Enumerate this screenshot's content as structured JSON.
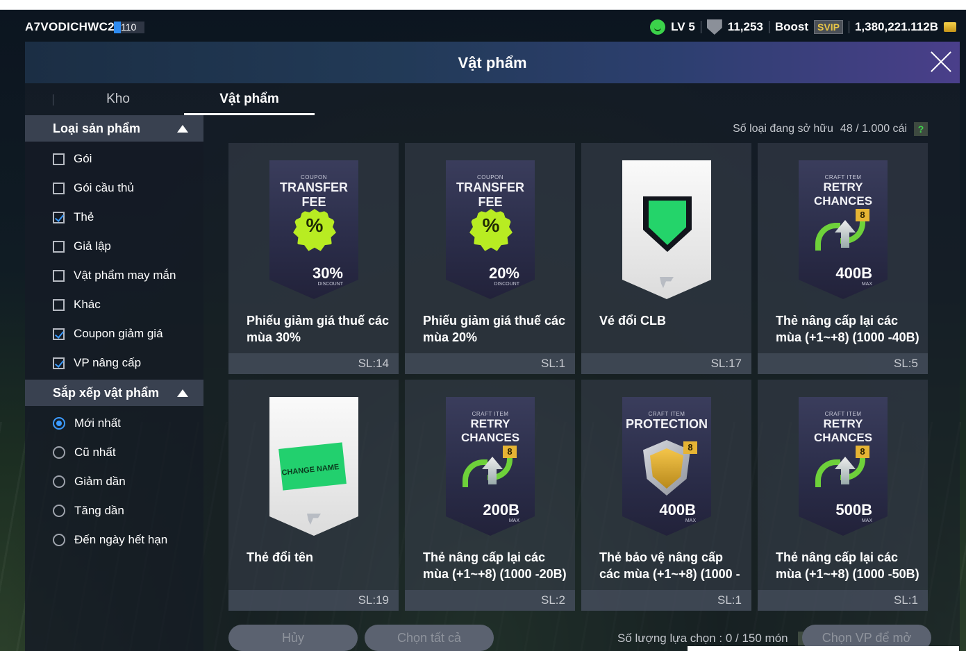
{
  "topbar": {
    "username": "A7VODICHWC26",
    "user_level": "110",
    "level": "LV 5",
    "points": "11,253",
    "boost": "Boost",
    "svip": "SVIP",
    "currency": "1,380,221.112B"
  },
  "header": {
    "title": "Vật phẩm"
  },
  "tabs": {
    "kho": "Kho",
    "vat_pham": "Vật phẩm"
  },
  "filter": {
    "title": "Loại sản phẩm",
    "options": [
      {
        "label": "Gói",
        "checked": false
      },
      {
        "label": "Gói cầu thủ",
        "checked": false
      },
      {
        "label": "Thẻ",
        "checked": true
      },
      {
        "label": "Giả lập",
        "checked": false
      },
      {
        "label": "Vật phẩm may mắn",
        "checked": false
      },
      {
        "label": "Khác",
        "checked": false
      },
      {
        "label": "Coupon giảm giá",
        "checked": true
      },
      {
        "label": "VP nâng cấp",
        "checked": true
      }
    ]
  },
  "sort": {
    "title": "Sắp xếp vật phẩm",
    "options": [
      {
        "label": "Mới nhất",
        "selected": true
      },
      {
        "label": "Cũ nhất",
        "selected": false
      },
      {
        "label": "Giảm dần",
        "selected": false
      },
      {
        "label": "Tăng dần",
        "selected": false
      },
      {
        "label": "Đến ngày hết hạn",
        "selected": false
      }
    ]
  },
  "owned": {
    "label": "Số loại đang sở hữu",
    "value": "48 / 1.000 cái",
    "help": "?"
  },
  "items": [
    {
      "name": "Phiếu giảm giá thuế các mùa 30%",
      "qty": "SL:14",
      "art_sub": "COUPON",
      "art_main": "TRANSFER FEE",
      "art_big": "30%",
      "art_small": "DISCOUNT",
      "badge": "%"
    },
    {
      "name": "Phiếu giảm giá thuế các mùa 20%",
      "qty": "SL:1",
      "art_sub": "COUPON",
      "art_main": "TRANSFER FEE",
      "art_big": "20%",
      "art_small": "DISCOUNT",
      "badge": "%"
    },
    {
      "name": "Vé đổi CLB",
      "qty": "SL:17"
    },
    {
      "name": "Thẻ nâng cấp lại các mùa (+1~+8) (1000 -40B)",
      "qty": "SL:5",
      "art_sub": "CRAFT ITEM",
      "art_main": "RETRY CHANCES",
      "art_big": "400B",
      "art_small": "MAX",
      "tag": "8"
    },
    {
      "name": "Thẻ đổi tên",
      "qty": "SL:19",
      "art_ticket": "CHANGE NAME"
    },
    {
      "name": "Thẻ nâng cấp lại các mùa (+1~+8) (1000 -20B)",
      "qty": "SL:2",
      "art_sub": "CRAFT ITEM",
      "art_main": "RETRY CHANCES",
      "art_big": "200B",
      "art_small": "MAX",
      "tag": "8"
    },
    {
      "name": "Thẻ bảo vệ nâng cấp các mùa (+1~+8) (1000 -",
      "qty": "SL:1",
      "art_sub": "CRAFT ITEM",
      "art_main": "PROTECTION",
      "art_big": "400B",
      "art_small": "MAX",
      "tag": "8"
    },
    {
      "name": "Thẻ nâng cấp lại các mùa (+1~+8) (1000 -50B)",
      "qty": "SL:1",
      "art_sub": "CRAFT ITEM",
      "art_main": "RETRY CHANCES",
      "art_big": "500B",
      "art_small": "MAX",
      "tag": "8"
    }
  ],
  "bottom": {
    "cancel": "Hủy",
    "select_all": "Chọn tất cả",
    "selection_label": "Số lượng lựa chọn : 0 / 150 món",
    "help": "?",
    "open": "Chọn VP để mở"
  }
}
